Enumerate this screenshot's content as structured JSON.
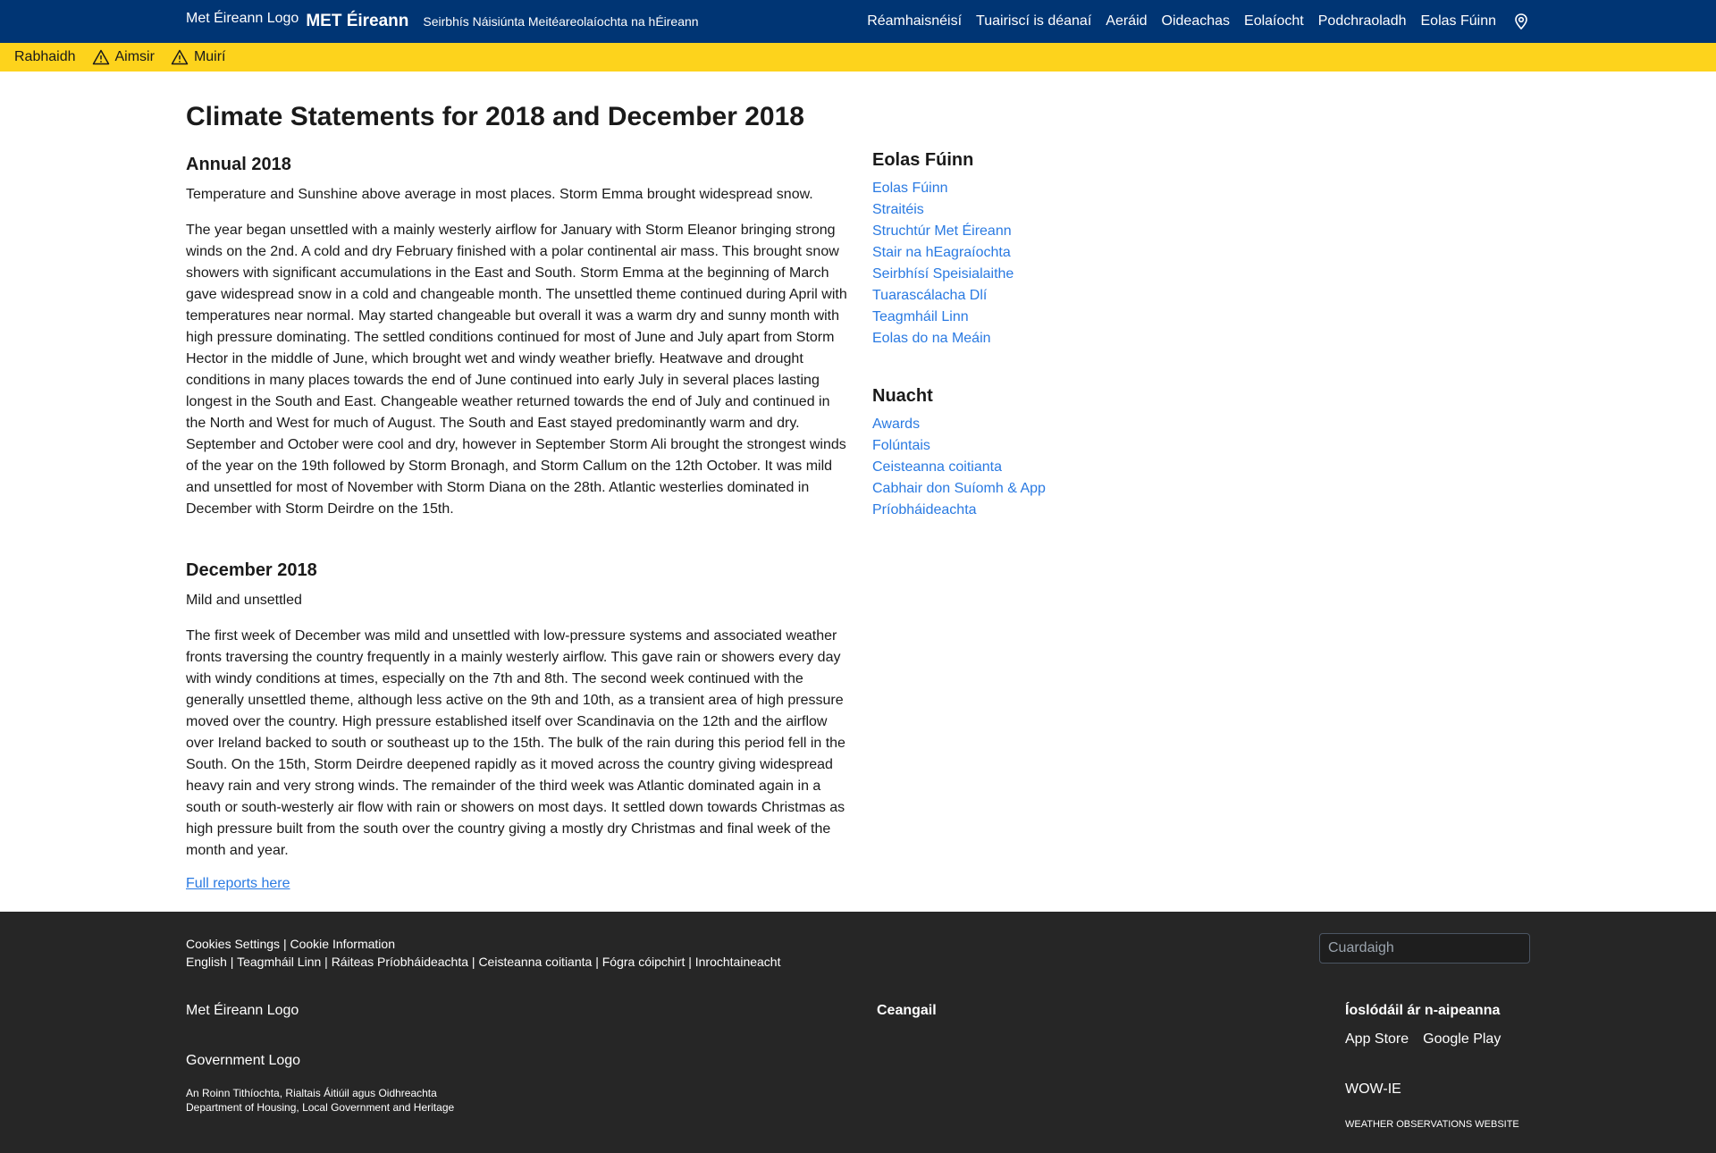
{
  "header": {
    "logo_alt": "Met Éireann Logo",
    "brand": "MET Éireann",
    "tagline": "Seirbhís Náisiúnta Meitéareolaíochta na hÉireann",
    "nav": [
      "Réamhaisnéisí",
      "Tuairiscí is déanaí",
      "Aeráid",
      "Oideachas",
      "Eolaíocht",
      "Podchraoladh",
      "Eolas Fúinn"
    ],
    "location_icon": "map-pin-icon"
  },
  "warnings": {
    "label": "Rabhaidh",
    "items": [
      "Aimsir",
      "Muirí"
    ],
    "icon": "warning-triangle-icon",
    "color": "#fdd31c"
  },
  "main": {
    "title": "Climate Statements for 2018 and December 2018",
    "annual": {
      "heading": "Annual 2018",
      "summary": "Temperature and Sunshine above average in most places. Storm Emma brought widespread snow.",
      "body": "The year began unsettled with a mainly westerly airflow for January with Storm Eleanor bringing strong winds on the 2nd. A cold and dry February finished with a polar continental air mass. This brought snow showers with significant accumulations in the East and South. Storm Emma at the beginning of March gave widespread snow in a cold and changeable month. The unsettled theme continued during April with temperatures near normal. May started changeable but overall it was a warm dry and sunny month with high pressure dominating. The settled conditions continued for most of June and July apart from Storm Hector in the middle of June, which brought wet and windy weather briefly. Heatwave and drought conditions in many places towards the end of June continued into early July in several places lasting longest in the South and East. Changeable weather returned towards the end of July and continued in the North and West for much of August. The South and East stayed predominantly warm and dry. September and October were cool and dry, however in September Storm Ali brought the strongest winds of the year on the 19th followed by Storm Bronagh, and Storm Callum on the 12th October. It was mild and unsettled for most of November with Storm Diana on the 28th. Atlantic westerlies dominated in December with Storm Deirdre on the 15th."
    },
    "december": {
      "heading": "December 2018",
      "summary": "Mild and unsettled",
      "body": "The first week of December was mild and unsettled with low-pressure systems and associated weather fronts traversing the country frequently in a mainly westerly airflow. This gave rain or showers every day with windy conditions at times, especially on the 7th and 8th. The second week continued with the generally unsettled theme, although less active on the 9th and 10th, as a transient area of high pressure moved over the country. High pressure established itself over Scandinavia on the 12th and the airflow over Ireland backed to south or southeast up to the 15th. The bulk of the rain during this period fell in the South. On the 15th, Storm Deirdre deepened rapidly as it moved across the country giving widespread heavy rain and very strong winds. The remainder of the third week was Atlantic dominated again in a south or south-westerly air flow with rain or showers on most days. It settled down towards Christmas as high pressure built from the south over the country giving a mostly dry Christmas and final week of the month and year."
    },
    "full_reports_link": "Full reports here"
  },
  "sidebar": {
    "about_heading": "Eolas Fúinn",
    "about_links": [
      "Eolas Fúinn",
      "Straitéis",
      "Struchtúr Met Éireann",
      "Stair na hEagraíochta",
      "Seirbhísí Speisialaithe",
      "Tuarascálacha Dlí",
      "Teagmháil Linn",
      "Eolas do na Meáin"
    ],
    "news_heading": "Nuacht",
    "news_links": [
      "Awards",
      "Folúntais",
      "Ceisteanna coitianta",
      "Cabhair don Suíomh & App",
      "Príobháideachta"
    ],
    "link_color": "#2a7ae2"
  },
  "footer": {
    "cookies_settings": "Cookies Settings",
    "cookie_information": "Cookie Information",
    "links": [
      "English",
      "Teagmháil Linn",
      "Ráiteas Príobháideachta",
      "Ceisteanna coitianta",
      "Fógra cóipchirt",
      "Inrochtaineacht"
    ],
    "search_placeholder": "Cuardaigh",
    "logo_alt": "Met Éireann Logo",
    "gov_logo_alt": "Government Logo",
    "dept_line1": "An Roinn Tithíochta, Rialtais Áitiúil agus Oidhreachta",
    "dept_line2": "Department of Housing, Local Government and Heritage",
    "links_heading": "Ceangail",
    "apps_heading": "Íoslódáil ár n-aipeanna",
    "app_store": "App Store",
    "google_play": "Google Play",
    "wow_alt": "WOW-IE",
    "wow_sub": "WEATHER OBSERVATIONS WEBSITE",
    "background": "#262626"
  }
}
